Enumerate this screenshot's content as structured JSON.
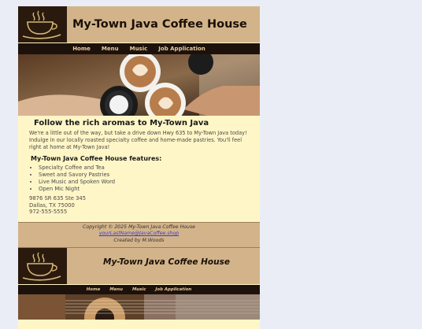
{
  "site": {
    "title": "My-Town Java Coffee House",
    "nav": [
      "Home",
      "Menu",
      "Music",
      "Job Application"
    ]
  },
  "main": {
    "heading": "Follow the rich aromas to My-Town Java",
    "intro": "We're a little out of the way, but take a drive down Hwy 635 to My-Town Java today! Indulge in our locally roasted specialty coffee and home-made pastries. You'll feel right at home at My-Town Java!",
    "features_heading": "My-Town Java Coffee House features:",
    "features": [
      "Specialty Coffee and Tea",
      "Sweet and Savory Pastries",
      "Live Music and Spoken Word",
      "Open Mic Night"
    ],
    "address": [
      "9876 SR 635 Ste 345",
      "Dallas, TX 75000",
      "972-555-5555"
    ]
  },
  "footer": {
    "copyright": "Copyright © 2025 My-Town Java Coffee House",
    "email": "yourLastName@JavaCoffee.shop",
    "credit": "Created by M.Woods"
  },
  "colors": {
    "page_bg": "#eaedf5",
    "header_bg": "#d3b48a",
    "nav_bg": "#1d120b",
    "content_bg": "#fff6c7"
  },
  "icons": [
    "coffee-cup-logo-icon"
  ]
}
